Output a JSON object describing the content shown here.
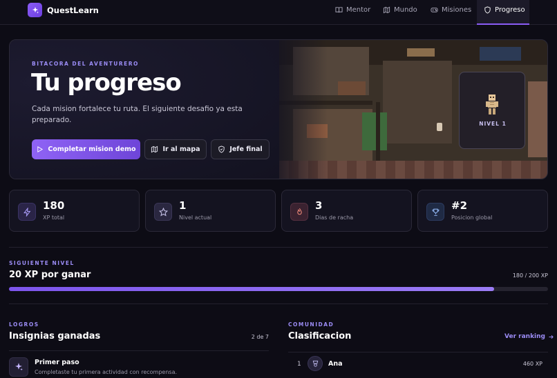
{
  "app": {
    "name": "QuestLearn"
  },
  "nav": {
    "items": [
      "Mentor",
      "Mundo",
      "Misiones",
      "Progreso"
    ],
    "active": "Progreso"
  },
  "hero": {
    "kicker": "BITACORA DEL AVENTURERO",
    "title": "Tu progreso",
    "subtitle": "Cada mision fortalece tu ruta. El siguiente desafio ya esta preparado.",
    "primary_button": "Completar mision demo",
    "map_button": "Ir al mapa",
    "boss_button": "Jefe final",
    "level_badge": "NIVEL 1"
  },
  "stats": [
    {
      "value": "180",
      "label": "XP total",
      "icon": "lightning-icon"
    },
    {
      "value": "1",
      "label": "Nivel actual",
      "icon": "star-icon"
    },
    {
      "value": "3",
      "label": "Dias de racha",
      "icon": "flame-icon"
    },
    {
      "value": "#2",
      "label": "Posicion global",
      "icon": "trophy-icon"
    }
  ],
  "next_level": {
    "kicker": "SIGUIENTE NIVEL",
    "title": "20 XP por ganar",
    "xp_text": "180 / 200 XP",
    "progress": 0.9
  },
  "achievements": {
    "kicker": "LOGROS",
    "title": "Insignias ganadas",
    "count": "2 de 7",
    "items": [
      {
        "title": "Primer paso",
        "desc": "Completaste tu primera actividad con recompensa."
      }
    ]
  },
  "community": {
    "kicker": "COMUNIDAD",
    "title": "Clasificacion",
    "link": "Ver ranking",
    "rows": [
      {
        "rank": "1",
        "name": "Ana",
        "xp": "460 XP"
      }
    ]
  },
  "colors": {
    "accent": "#8b5cf6",
    "background": "#0d0c15"
  }
}
